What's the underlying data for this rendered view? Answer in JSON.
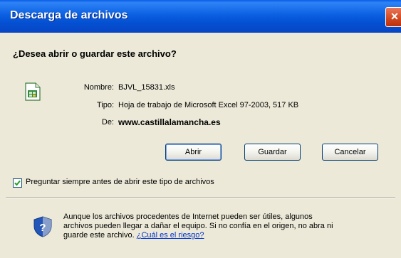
{
  "window": {
    "title": "Descarga de archivos",
    "close_symbol": "×"
  },
  "dialog": {
    "question": "¿Desea abrir o guardar este archivo?",
    "file": {
      "name_label": "Nombre:",
      "name_value": "BJVL_15831.xls",
      "type_label": "Tipo:",
      "type_value": "Hoja de trabajo de Microsoft Excel 97-2003, 517 KB",
      "from_label": "De:",
      "from_value": "www.castillalamancha.es",
      "icon": "excel-file-icon"
    },
    "buttons": {
      "open": "Abrir",
      "save": "Guardar",
      "cancel": "Cancelar"
    },
    "checkbox": {
      "label": "Preguntar siempre antes de abrir este tipo de archivos",
      "checked": true
    },
    "warning": {
      "text": "Aunque los archivos procedentes de Internet pueden ser útiles, algunos archivos pueden llegar a dañar el equipo. Si no confía en el origen, no abra ni guarde este archivo.",
      "link": "¿Cuál es el riesgo?",
      "icon": "shield-question-icon"
    }
  },
  "colors": {
    "titlebar": "#0b60e2",
    "panel": "#ece9d8",
    "link": "#0033cc"
  }
}
